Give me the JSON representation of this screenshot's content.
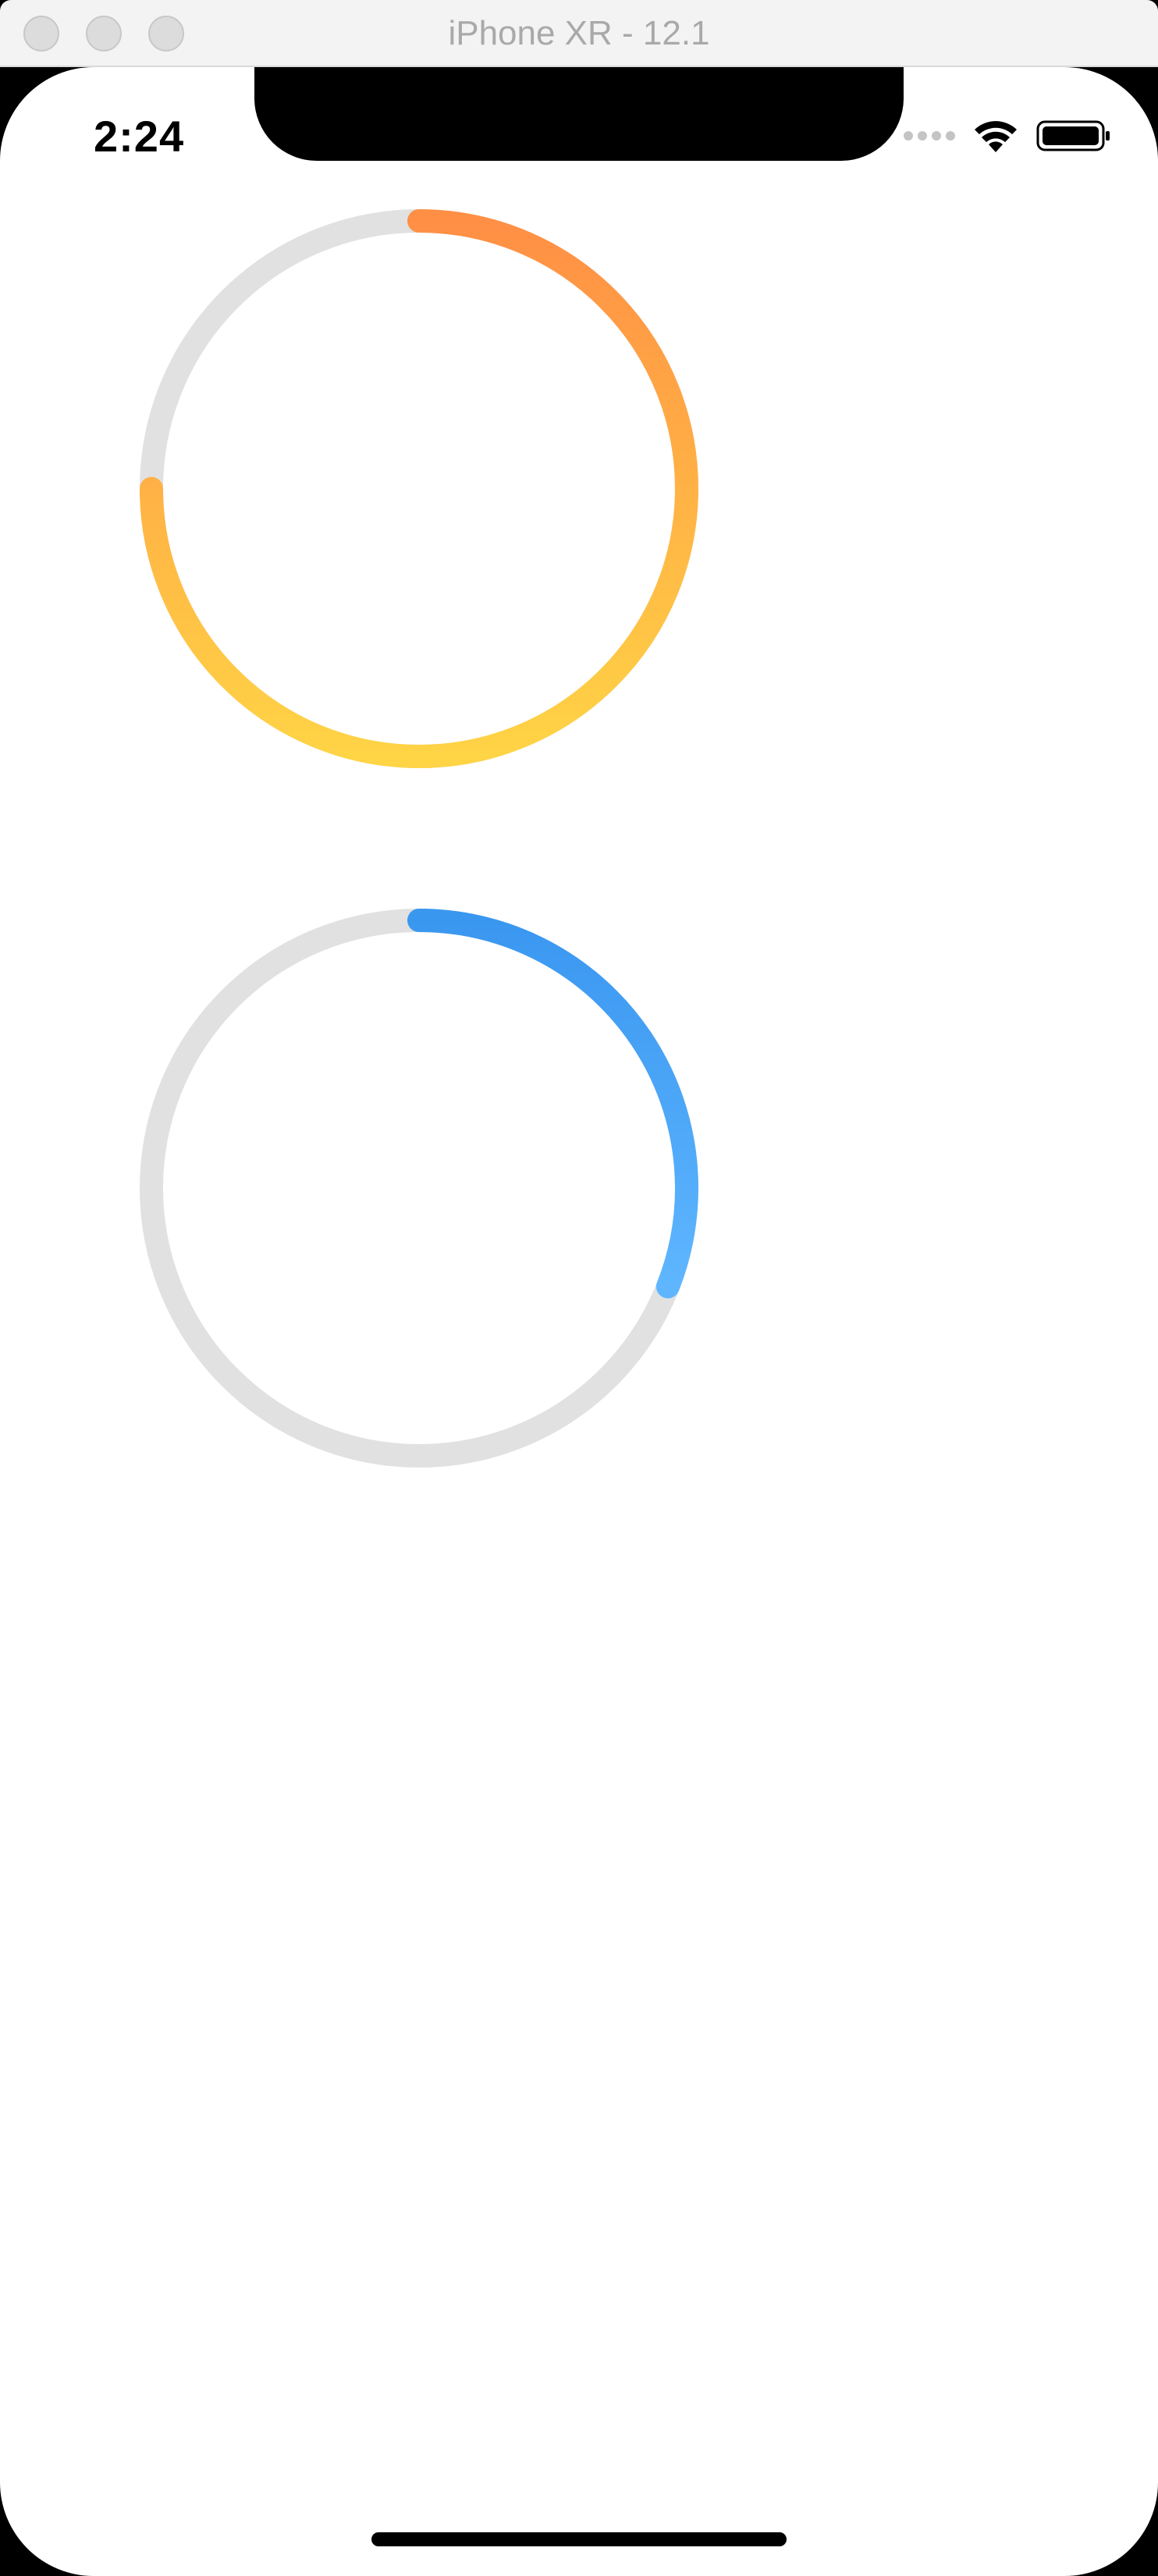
{
  "window": {
    "title": "iPhone XR - 12.1"
  },
  "status_bar": {
    "time": "2:24",
    "icons": [
      "cellular-signal-icon",
      "wifi-icon",
      "battery-icon"
    ]
  },
  "progress_rings": [
    {
      "name": "orange-progress-ring",
      "progress": 0.75,
      "track_color": "#e1e1e1",
      "gradient_start": "#ff8f45",
      "gradient_end": "#ffd445"
    },
    {
      "name": "blue-progress-ring",
      "progress": 0.31,
      "track_color": "#e1e1e1",
      "gradient_start": "#3a97f0",
      "gradient_end": "#5fb6ff"
    }
  ],
  "colors": {
    "background": "#ffffff",
    "titlebar": "#f3f3f3",
    "titlebar_text": "#a9a9a9"
  }
}
